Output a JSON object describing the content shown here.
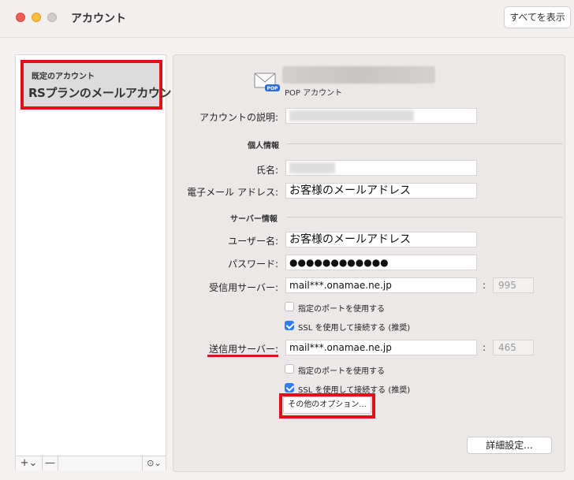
{
  "window": {
    "title": "アカウント",
    "show_all": "すべてを表示"
  },
  "sidebar": {
    "default_caption": "既定のアカウント",
    "account_name": "RSプランのメールアカウント",
    "add_label": "+⌄",
    "remove_label": "—",
    "more_label": "⊙⌄"
  },
  "account": {
    "type_label": "POP アカウント",
    "description_label": "アカウントの説明:",
    "personal_section": "個人情報",
    "name_label": "氏名:",
    "email_label": "電子メール アドレス:",
    "email_value": "お客様のメールアドレス",
    "server_section": "サーバー情報",
    "username_label": "ユーザー名:",
    "username_value": "お客様のメールアドレス",
    "password_label": "パスワード:",
    "password_value": "●●●●●●●●●●●●",
    "incoming_label": "受信用サーバー:",
    "incoming_value": "mail***.onamae.ne.jp",
    "incoming_port": "995",
    "incoming_custom_port": "指定のポートを使用する",
    "incoming_ssl": "SSL を使用して接続する (推奨)",
    "outgoing_label": "送信用サーバー:",
    "outgoing_value": "mail***.onamae.ne.jp",
    "outgoing_port": "465",
    "outgoing_custom_port": "指定のポートを使用する",
    "outgoing_ssl": "SSL を使用して接続する (推奨)",
    "more_options": "その他のオプション...",
    "advanced": "詳細設定..."
  },
  "colors": {
    "highlight": "#e0101a",
    "checkbox_on": "#2f7cf6"
  }
}
